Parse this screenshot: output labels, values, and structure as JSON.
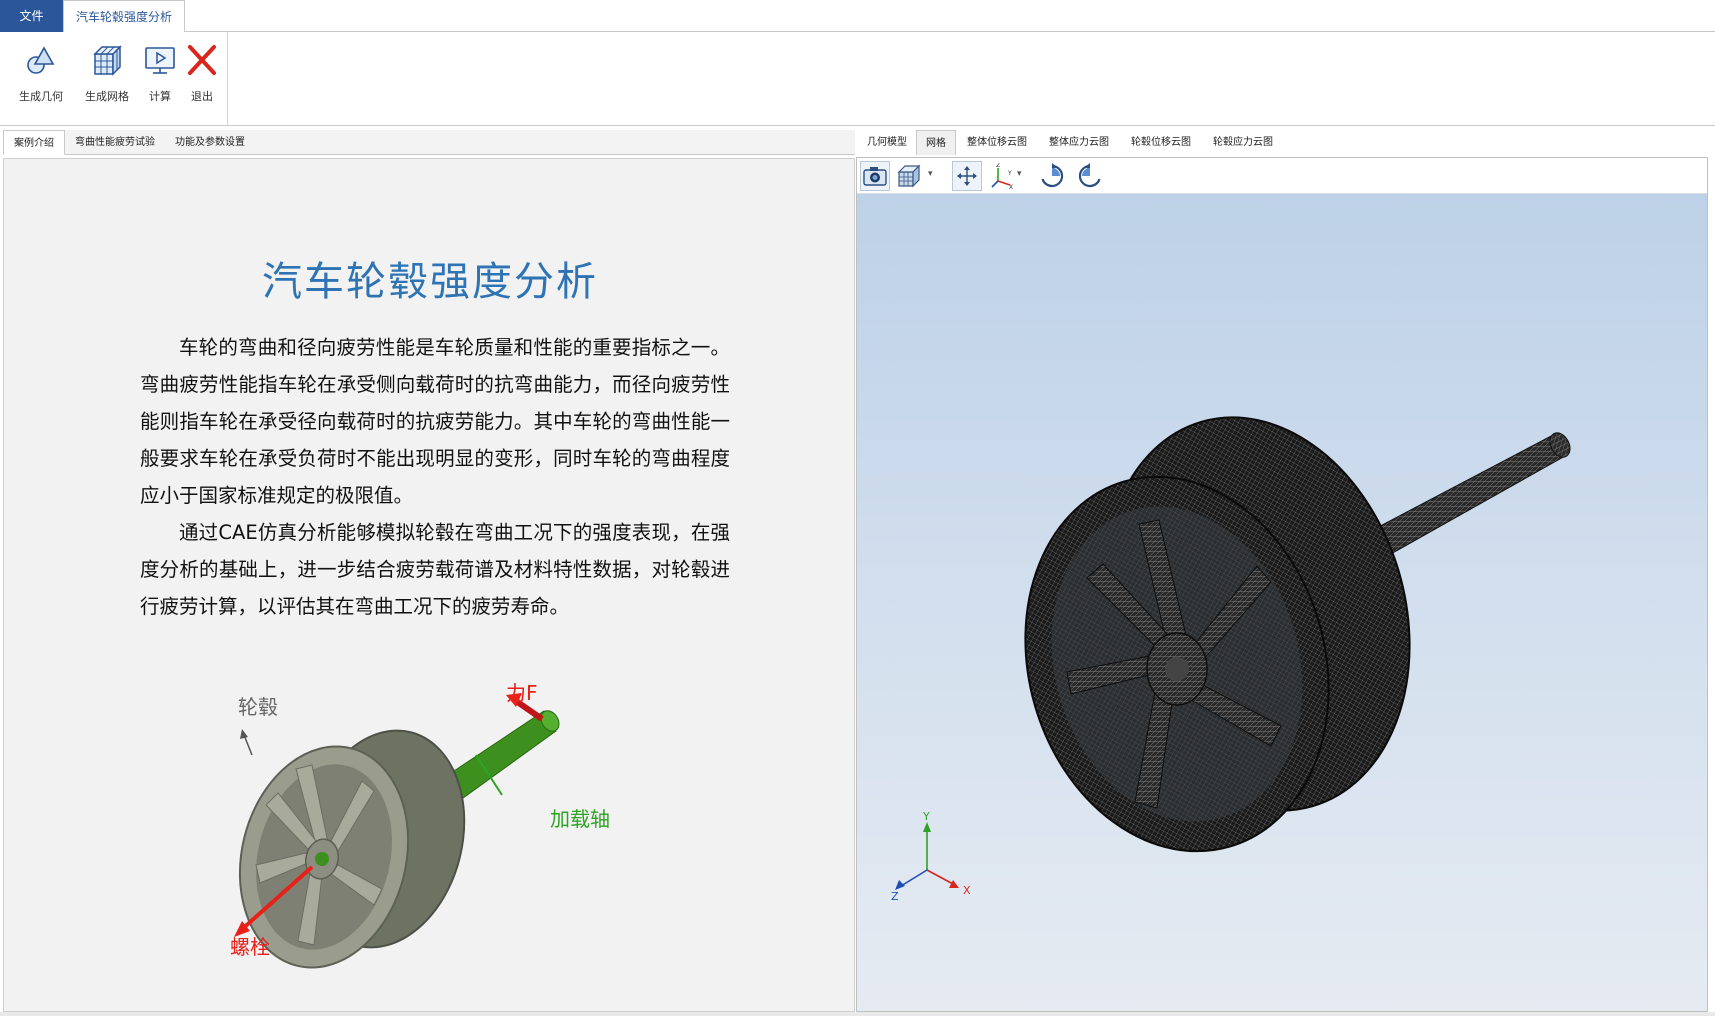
{
  "menu": {
    "file_label": "文件",
    "active_tab_label": "汽车轮毂强度分析"
  },
  "ribbon": {
    "buttons": [
      {
        "label": "生成几何",
        "icon": "geometry-icon"
      },
      {
        "label": "生成网格",
        "icon": "mesh-icon"
      },
      {
        "label": "计算",
        "icon": "compute-icon"
      },
      {
        "label": "退出",
        "icon": "exit-icon"
      }
    ]
  },
  "left": {
    "tabs": [
      "案例介绍",
      "弯曲性能疲劳试验",
      "功能及参数设置"
    ],
    "active_tab": "案例介绍",
    "doc": {
      "title": "汽车轮毂强度分析",
      "paragraphs": [
        "车轮的弯曲和径向疲劳性能是车轮质量和性能的重要指标之一。弯曲疲劳性能指车轮在承受侧向载荷时的抗弯曲能力，而径向疲劳性能则指车轮在承受径向载荷时的抗疲劳能力。其中车轮的弯曲性能一般要求车轮在承受负荷时不能出现明显的变形，同时车轮的弯曲程度应小于国家标准规定的极限值。",
        "通过CAE仿真分析能够模拟轮毂在弯曲工况下的强度表现，在强度分析的基础上，进一步结合疲劳载荷谱及材料特性数据，对轮毂进行疲劳计算，以评估其在弯曲工况下的疲劳寿命。"
      ],
      "figure_labels": {
        "hub": "轮毂",
        "force": "力F",
        "shaft": "加载轴",
        "bolt": "螺栓"
      }
    }
  },
  "right": {
    "tabs": [
      "几何模型",
      "网格",
      "整体位移云图",
      "整体应力云图",
      "轮毂位移云图",
      "轮毂应力云图"
    ],
    "active_tab": "网格",
    "toolbar": [
      "camera-icon",
      "view-cube-icon",
      "fit-view-icon",
      "axis-orientation-icon",
      "rotate-cw-icon",
      "rotate-ccw-icon"
    ],
    "axes": {
      "x": "X",
      "y": "Y",
      "z": "Z"
    }
  },
  "colors": {
    "accent": "#2b579a",
    "title_blue": "#2e74b5",
    "label_red": "#e8201a",
    "label_green": "#2ea324",
    "label_gray": "#666666"
  }
}
